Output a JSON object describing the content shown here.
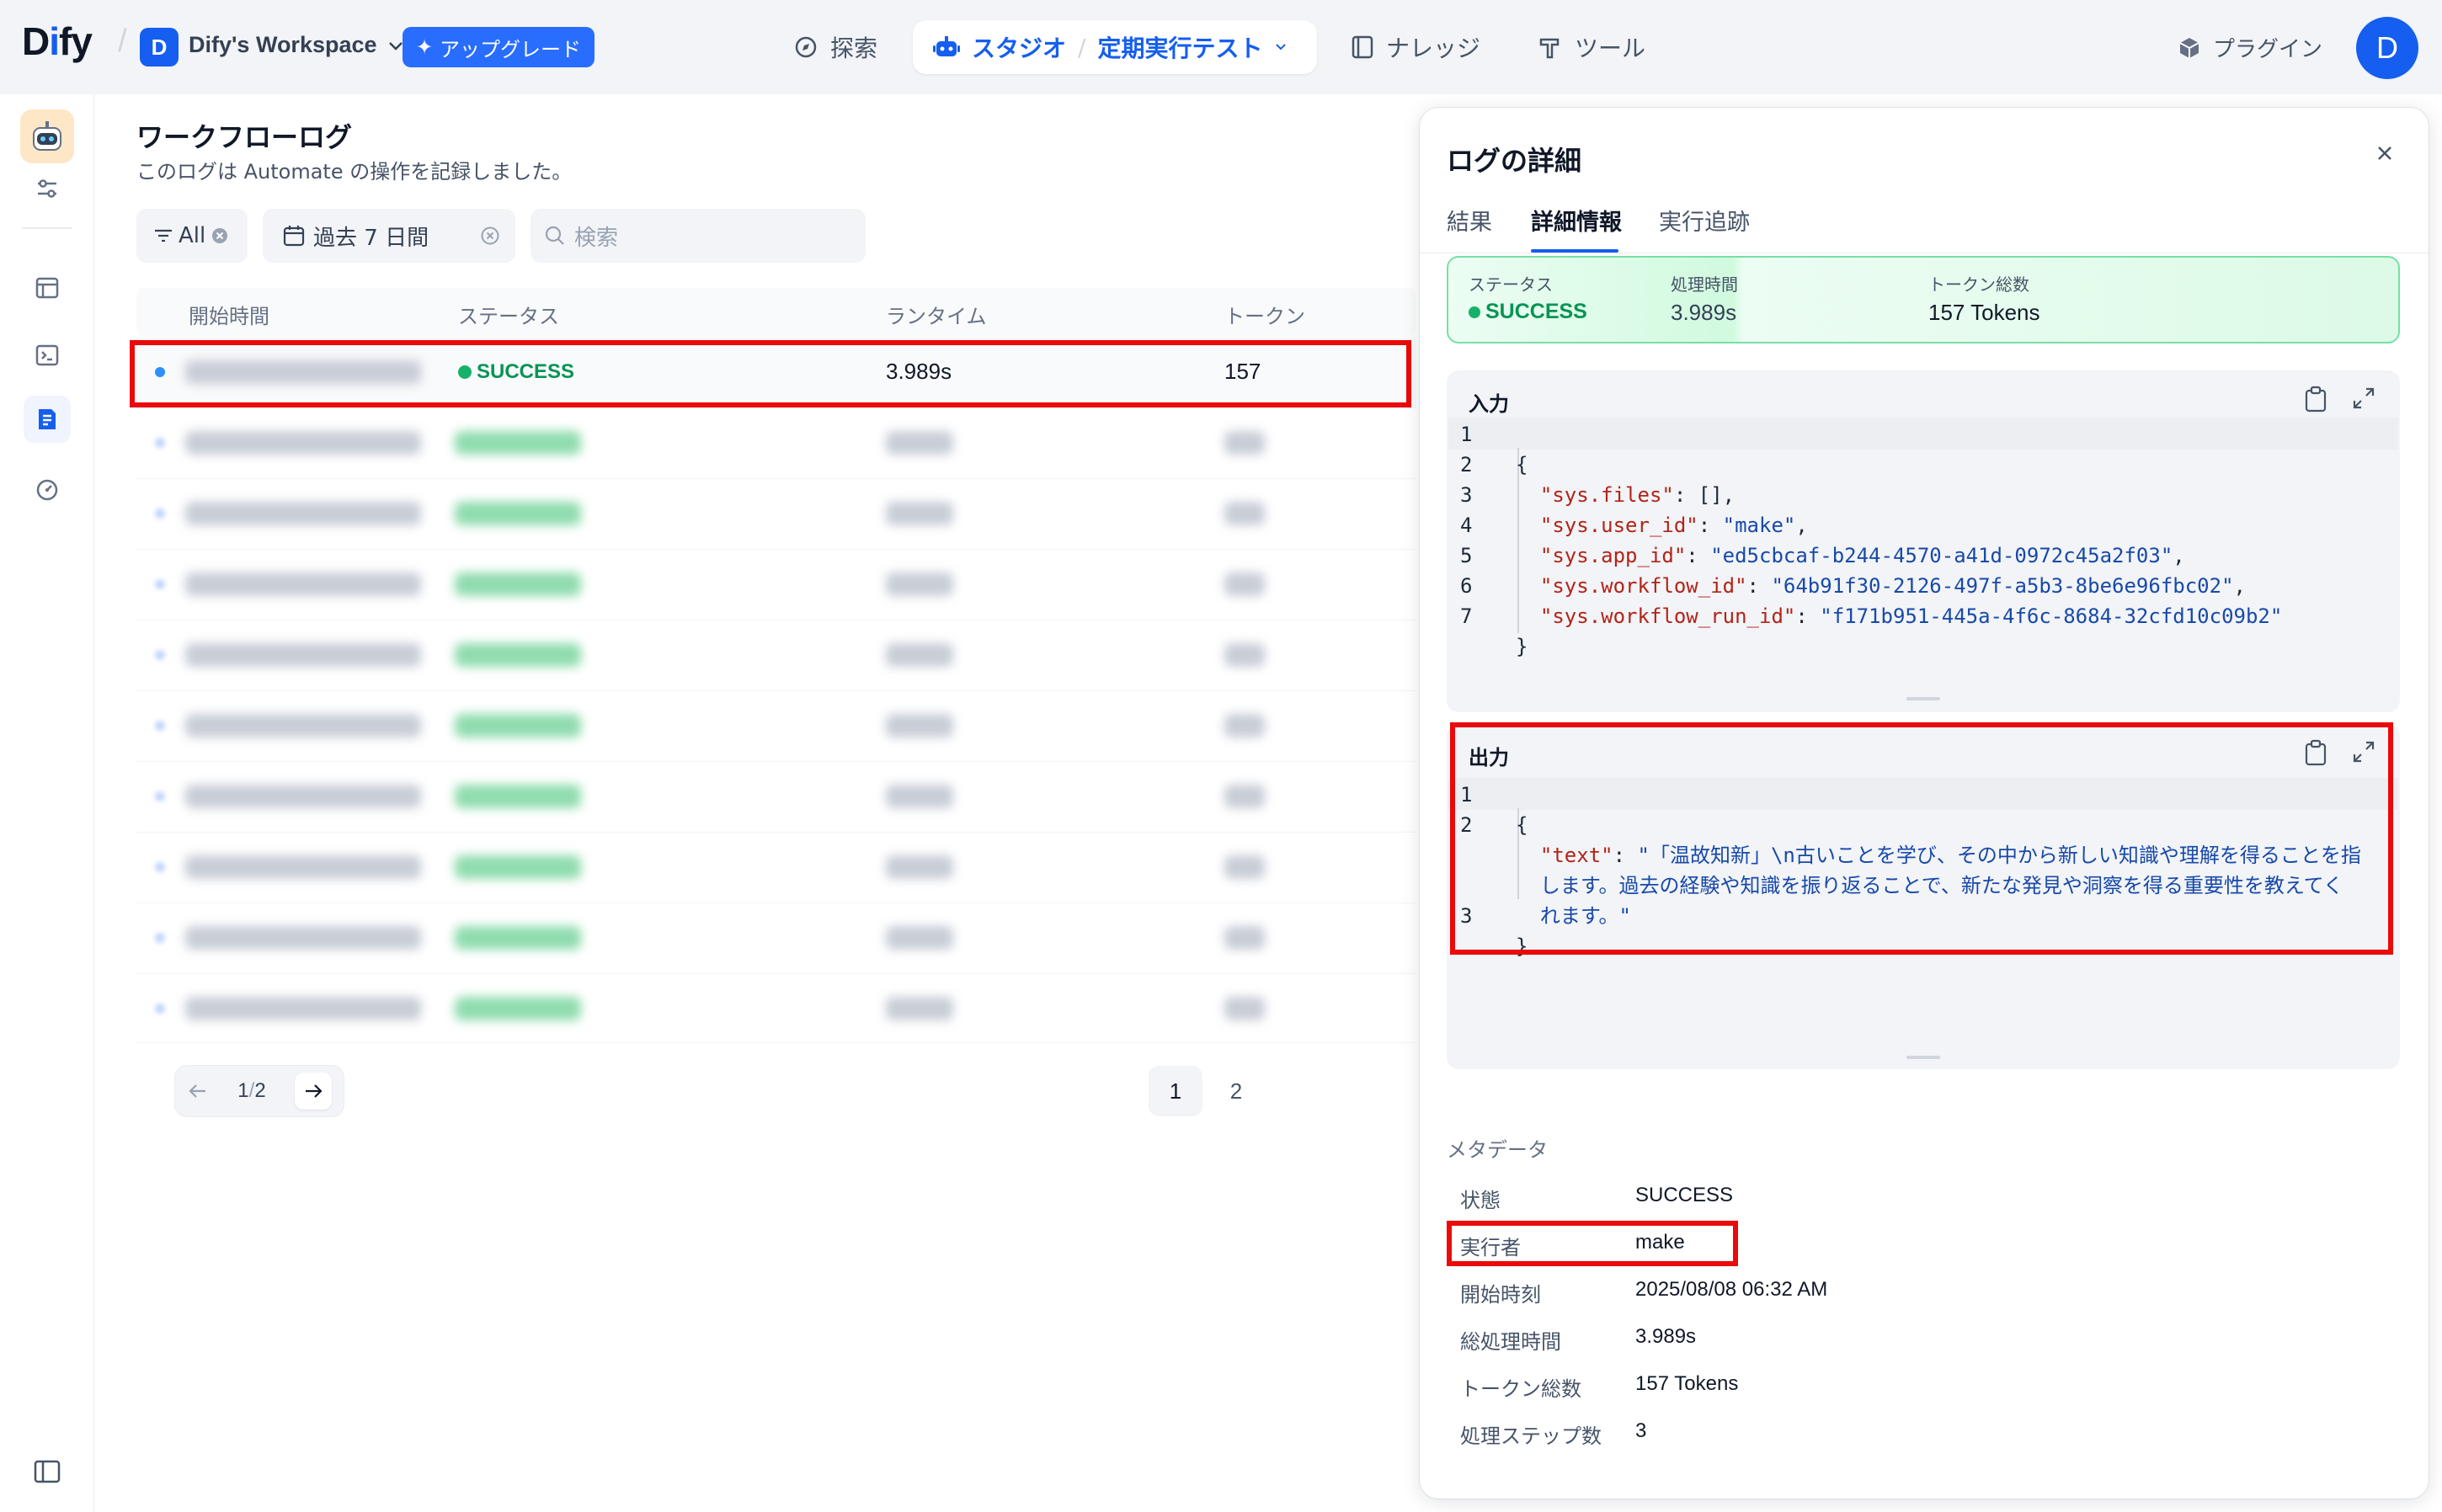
{
  "topbar": {
    "logo_pre": "D",
    "logo_i": "i",
    "logo_post": "fy",
    "workspace_initial": "D",
    "workspace_name": "Dify's Workspace",
    "upgrade_label": "アップグレード",
    "nav_explore": "探索",
    "nav_studio": "スタジオ",
    "app_name": "定期実行テスト",
    "nav_knowledge": "ナレッジ",
    "nav_tools": "ツール",
    "plugins": "プラグイン",
    "user_initial": "D"
  },
  "main": {
    "title": "ワークフローログ",
    "subtitle": "このログは Automate の操作を記録しました。",
    "filter_status": "All",
    "filter_period": "過去 7 日間",
    "search_placeholder": "検索",
    "columns": [
      "開始時間",
      "ステータス",
      "ランタイム",
      "トークン"
    ],
    "first_row": {
      "status": "SUCCESS",
      "runtime": "3.989s",
      "tokens": "157"
    },
    "pager": {
      "current": "1",
      "sep": "/",
      "total": "2"
    },
    "pages": [
      "1",
      "2"
    ]
  },
  "panel": {
    "title": "ログの詳細",
    "tabs": [
      "結果",
      "詳細情報",
      "実行追跡"
    ],
    "active_tab": "詳細情報",
    "summary": {
      "status_label": "ステータス",
      "status_value": "SUCCESS",
      "time_label": "処理時間",
      "time_value": "3.989s",
      "tokens_label": "トークン総数",
      "tokens_value": "157 Tokens"
    },
    "input": {
      "label": "入力",
      "line_numbers": [
        "1",
        "2",
        "3",
        "4",
        "5",
        "6",
        "7"
      ],
      "keys": [
        "\"sys.files\"",
        "\"sys.user_id\"",
        "\"sys.app_id\"",
        "\"sys.workflow_id\"",
        "\"sys.workflow_run_id\""
      ],
      "values": [
        "[]",
        "\"make\"",
        "\"ed5cbcaf-b244-4570-a41d-0972c45a2f03\"",
        "\"64b91f30-2126-497f-a5b3-8be6e96fbc02\"",
        "\"f171b951-445a-4f6c-8684-32cfd10c09b2\""
      ]
    },
    "output": {
      "label": "出力",
      "line_numbers": [
        "1",
        "2",
        "3"
      ],
      "key": "\"text\"",
      "value_line1": "\"「温故知新」\\n古いことを学び、その中から新しい知識や理解を得ることを指",
      "value_line2": "します。過去の経験や知識を振り返ることで、新たな発見や洞察を得る重要性を教えてく",
      "value_line3": "れます。\""
    },
    "metadata": {
      "heading": "メタデータ",
      "rows": [
        {
          "key": "状態",
          "value": "SUCCESS"
        },
        {
          "key": "実行者",
          "value": "make"
        },
        {
          "key": "開始時刻",
          "value": "2025/08/08 06:32 AM"
        },
        {
          "key": "総処理時間",
          "value": "3.989s"
        },
        {
          "key": "トークン総数",
          "value": "157 Tokens"
        },
        {
          "key": "処理ステップ数",
          "value": "3"
        }
      ]
    }
  },
  "colors": {
    "accent": "#155eef",
    "success": "#079455",
    "highlight_red": "#ea0a0a",
    "json_key": "#b42318",
    "json_string": "#1849a9"
  }
}
